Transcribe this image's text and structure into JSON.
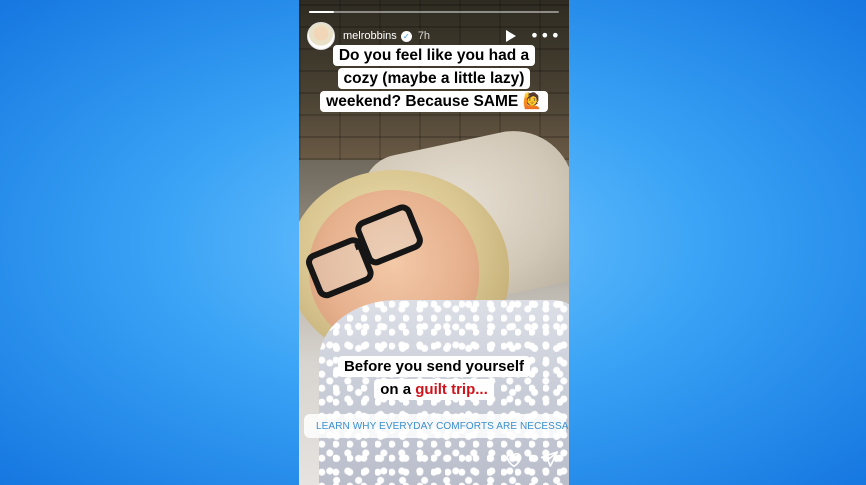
{
  "story": {
    "progress": 0.1,
    "username": "melrobbins",
    "time": "7h",
    "caption_top": [
      "Do you feel like you had a",
      "cozy (maybe a little lazy)",
      "weekend? Because SAME 🙋"
    ],
    "caption_bottom_line1": "Before you send yourself",
    "caption_bottom_line2_prefix": "on a ",
    "caption_bottom_line2_highlight": "guilt trip...",
    "link_sticker_text": "LEARN WHY EVERYDAY COMFORTS ARE NECESSARY"
  },
  "colors": {
    "background": "#3aa3f5",
    "highlight_red": "#d0131b",
    "link_blue": "#3a8fcf"
  },
  "icons": [
    "verified-badge-icon",
    "play-icon",
    "more-icon",
    "link-icon",
    "heart-icon",
    "send-icon"
  ]
}
